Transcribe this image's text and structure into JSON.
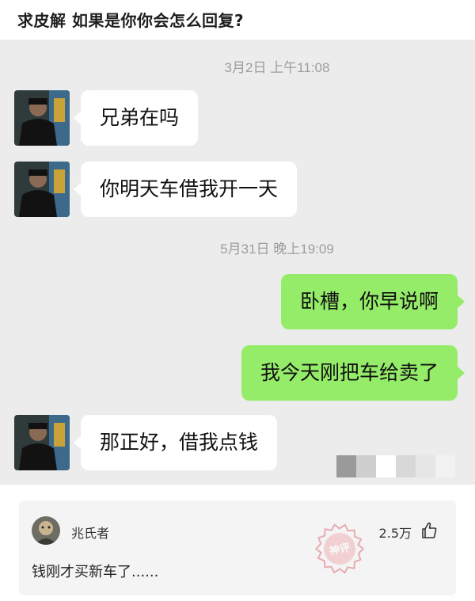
{
  "post": {
    "title": "求皮解 如果是你你会怎么回复?"
  },
  "chat": {
    "timestamps": [
      "3月2日 上午11:08",
      "5月31日 晚上19:09"
    ],
    "messages": [
      {
        "side": "left",
        "text": "兄弟在吗"
      },
      {
        "side": "left",
        "text": "你明天车借我开一天"
      },
      {
        "side": "right",
        "text": "卧槽，你早说啊"
      },
      {
        "side": "right",
        "text": "我今天刚把车给卖了"
      },
      {
        "side": "left",
        "text": "那正好，借我点钱"
      }
    ],
    "colors": {
      "background": "#ececec",
      "incoming_bubble": "#ffffff",
      "outgoing_bubble": "#95ec69",
      "timestamp": "#9d9d9d"
    }
  },
  "comment": {
    "username": "兆氏者",
    "likes": "2.5万",
    "text": "钱刚才买新车了......",
    "stamp_text": "神评",
    "icons": {
      "avatar": "user-avatar",
      "like": "thumbs-up-icon",
      "stamp": "top-comment-stamp"
    }
  }
}
